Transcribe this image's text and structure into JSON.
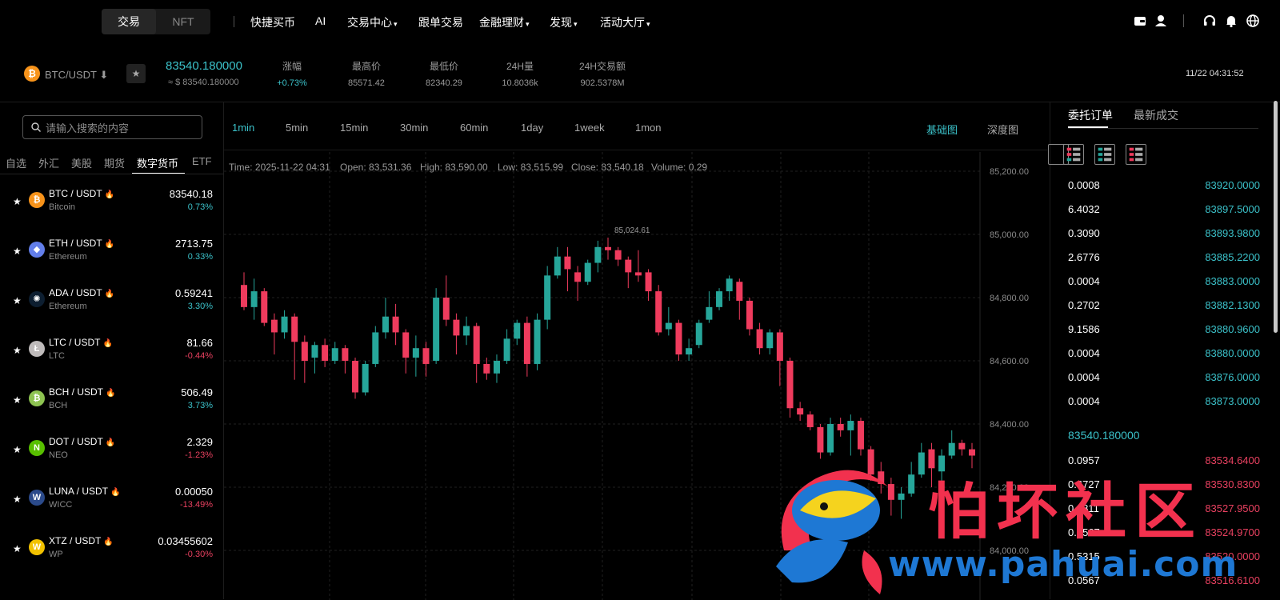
{
  "topnav": {
    "seg_active": "交易",
    "seg_other": "NFT",
    "items": [
      {
        "label": "快捷买币",
        "has_caret": false
      },
      {
        "label": "AI",
        "has_caret": false
      },
      {
        "label": "交易中心",
        "has_caret": true
      },
      {
        "label": "跟单交易",
        "has_caret": false
      },
      {
        "label": "金融理财",
        "has_caret": true
      },
      {
        "label": "发现",
        "has_caret": true
      },
      {
        "label": "活动大厅",
        "has_caret": true
      }
    ],
    "caret_glyph": "▾",
    "right_icons": [
      "wallet-icon",
      "user-icon",
      "headset-icon",
      "bell-icon",
      "globe-icon"
    ]
  },
  "ticker": {
    "pair": "BTC/USDT ⬇",
    "last_price": "83540.180000",
    "approx": "≈ $ 83540.180000",
    "stats": [
      {
        "label": "涨幅",
        "value": "+0.73%",
        "up": true
      },
      {
        "label": "最高价",
        "value": "85571.42",
        "up": false
      },
      {
        "label": "最低价",
        "value": "82340.29",
        "up": false
      },
      {
        "label": "24H量",
        "value": "10.8036k",
        "up": false
      },
      {
        "label": "24H交易额",
        "value": "902.5378M",
        "up": false
      }
    ],
    "clock": "11/22 04:31:52"
  },
  "left": {
    "search_placeholder": "请输入搜索的内容",
    "tabs": [
      "自选",
      "外汇",
      "美股",
      "期货",
      "数字货币",
      "ETF"
    ],
    "active_tab": "数字货币",
    "markets": [
      {
        "symbol": "BTC / USDT",
        "name": "Bitcoin",
        "price": "83540.18",
        "change": "0.73%",
        "dir": "up",
        "icon_color": "#f7931a",
        "icon_glyph": "₿"
      },
      {
        "symbol": "ETH / USDT",
        "name": "Ethereum",
        "price": "2713.75",
        "change": "0.33%",
        "dir": "up",
        "icon_color": "#627eea",
        "icon_glyph": "◆"
      },
      {
        "symbol": "ADA / USDT",
        "name": "Ethereum",
        "price": "0.59241",
        "change": "3.30%",
        "dir": "up",
        "icon_color": "#0d1e30",
        "icon_glyph": "✺"
      },
      {
        "symbol": "LTC / USDT",
        "name": "LTC",
        "price": "81.66",
        "change": "-0.44%",
        "dir": "down",
        "icon_color": "#bfbbbb",
        "icon_glyph": "Ł"
      },
      {
        "symbol": "BCH / USDT",
        "name": "BCH",
        "price": "506.49",
        "change": "3.73%",
        "dir": "up",
        "icon_color": "#8dc351",
        "icon_glyph": "₿"
      },
      {
        "symbol": "DOT / USDT",
        "name": "NEO",
        "price": "2.329",
        "change": "-1.23%",
        "dir": "down",
        "icon_color": "#58bf00",
        "icon_glyph": "N"
      },
      {
        "symbol": "LUNA / USDT",
        "name": "WICC",
        "price": "0.00050",
        "change": "-13.49%",
        "dir": "down",
        "icon_color": "#2b4a8a",
        "icon_glyph": "W"
      },
      {
        "symbol": "XTZ / USDT",
        "name": "WP",
        "price": "0.03455602",
        "change": "-0.30%",
        "dir": "down",
        "icon_color": "#f2c200",
        "icon_glyph": "W"
      }
    ]
  },
  "chart": {
    "intervals": [
      "1min",
      "5min",
      "15min",
      "30min",
      "60min",
      "1day",
      "1week",
      "1mon"
    ],
    "active_interval": "1min",
    "chart_types": [
      "基础图",
      "深度图"
    ],
    "active_type": "基础图",
    "ohlc": {
      "time": "Time: 2025-11-22 04:31",
      "open": "Open: 83,531.36",
      "high": "High: 83,590.00",
      "low": "Low: 83,515.99",
      "close": "Close: 83,540.18",
      "volume": "Volume: 0.29"
    },
    "peak_label": "85,024.61",
    "up_color": "#26a69a",
    "down_color": "#ef3b5d"
  },
  "chart_data": {
    "type": "candlestick",
    "y_ticks": [
      "85,200.00",
      "85,000.00",
      "84,800.00",
      "84,600.00",
      "84,400.00",
      "84,200.00",
      "84,000.00"
    ],
    "ylim": [
      83880,
      85240
    ],
    "candles": [
      [
        84840,
        84770,
        84880,
        84760
      ],
      [
        84770,
        84820,
        84860,
        84730
      ],
      [
        84820,
        84720,
        84830,
        84710
      ],
      [
        84730,
        84690,
        84750,
        84620
      ],
      [
        84690,
        84740,
        84760,
        84670
      ],
      [
        84740,
        84660,
        84750,
        84540
      ],
      [
        84660,
        84600,
        84680,
        84530
      ],
      [
        84610,
        84650,
        84660,
        84560
      ],
      [
        84650,
        84600,
        84670,
        84580
      ],
      [
        84600,
        84640,
        84660,
        84590
      ],
      [
        84640,
        84600,
        84650,
        84560
      ],
      [
        84600,
        84500,
        84610,
        84480
      ],
      [
        84500,
        84590,
        84600,
        84490
      ],
      [
        84590,
        84690,
        84710,
        84580
      ],
      [
        84690,
        84740,
        84800,
        84670
      ],
      [
        84740,
        84690,
        84780,
        84650
      ],
      [
        84690,
        84610,
        84700,
        84560
      ],
      [
        84610,
        84640,
        84680,
        84550
      ],
      [
        84640,
        84590,
        84660,
        84550
      ],
      [
        84600,
        84800,
        84830,
        84590
      ],
      [
        84800,
        84730,
        84870,
        84710
      ],
      [
        84730,
        84680,
        84750,
        84620
      ],
      [
        84680,
        84710,
        84740,
        84650
      ],
      [
        84710,
        84590,
        84720,
        84530
      ],
      [
        84590,
        84560,
        84610,
        84540
      ],
      [
        84560,
        84600,
        84620,
        84530
      ],
      [
        84600,
        84670,
        84700,
        84590
      ],
      [
        84670,
        84720,
        84730,
        84650
      ],
      [
        84720,
        84590,
        84740,
        84550
      ],
      [
        84590,
        84730,
        84750,
        84570
      ],
      [
        84730,
        84870,
        84900,
        84700
      ],
      [
        84870,
        84930,
        84960,
        84860
      ],
      [
        84930,
        84890,
        84960,
        84820
      ],
      [
        84880,
        84850,
        84900,
        84790
      ],
      [
        84850,
        84910,
        84920,
        84840
      ],
      [
        84910,
        84960,
        84980,
        84880
      ],
      [
        84960,
        84950,
        84990,
        84920
      ],
      [
        84950,
        84920,
        84960,
        84900
      ],
      [
        84920,
        84880,
        84930,
        84830
      ],
      [
        84880,
        84870,
        84950,
        84850
      ],
      [
        84880,
        84820,
        84890,
        84790
      ],
      [
        84820,
        84690,
        84840,
        84680
      ],
      [
        84700,
        84720,
        84770,
        84680
      ],
      [
        84720,
        84620,
        84730,
        84600
      ],
      [
        84620,
        84640,
        84670,
        84600
      ],
      [
        84650,
        84720,
        84730,
        84640
      ],
      [
        84730,
        84770,
        84820,
        84720
      ],
      [
        84770,
        84820,
        84830,
        84760
      ],
      [
        84820,
        84860,
        84870,
        84790
      ],
      [
        84850,
        84790,
        84860,
        84730
      ],
      [
        84790,
        84700,
        84800,
        84680
      ],
      [
        84700,
        84640,
        84720,
        84620
      ],
      [
        84640,
        84690,
        84700,
        84620
      ],
      [
        84690,
        84600,
        84700,
        84520
      ],
      [
        84600,
        84450,
        84610,
        84420
      ],
      [
        84450,
        84430,
        84470,
        84410
      ],
      [
        84430,
        84390,
        84440,
        84380
      ],
      [
        84390,
        84310,
        84400,
        84290
      ],
      [
        84310,
        84400,
        84420,
        84300
      ],
      [
        84400,
        84380,
        84420,
        84360
      ],
      [
        84380,
        84410,
        84430,
        84300
      ],
      [
        84410,
        84320,
        84420,
        84300
      ],
      [
        84320,
        84240,
        84330,
        84220
      ],
      [
        84250,
        84210,
        84280,
        84180
      ],
      [
        84210,
        84160,
        84230,
        84110
      ],
      [
        84160,
        84180,
        84200,
        84100
      ],
      [
        84180,
        84240,
        84280,
        84170
      ],
      [
        84240,
        84310,
        84340,
        84230
      ],
      [
        84320,
        84260,
        84340,
        84200
      ],
      [
        84250,
        84300,
        84320,
        84190
      ],
      [
        84300,
        84340,
        84380,
        84290
      ],
      [
        84340,
        84320,
        84350,
        84300
      ],
      [
        84320,
        84300,
        84340,
        84260
      ]
    ]
  },
  "orderbook": {
    "tabs": [
      "委托订单",
      "最新成交"
    ],
    "active_tab": "委托订单",
    "asks": [
      {
        "qty": "0.0008",
        "price": "83920.0000"
      },
      {
        "qty": "6.4032",
        "price": "83897.5000"
      },
      {
        "qty": "0.3090",
        "price": "83893.9800"
      },
      {
        "qty": "2.6776",
        "price": "83885.2200"
      },
      {
        "qty": "0.0004",
        "price": "83883.0000"
      },
      {
        "qty": "0.2702",
        "price": "83882.1300"
      },
      {
        "qty": "9.1586",
        "price": "83880.9600"
      },
      {
        "qty": "0.0004",
        "price": "83880.0000"
      },
      {
        "qty": "0.0004",
        "price": "83876.0000"
      },
      {
        "qty": "0.0004",
        "price": "83873.0000"
      }
    ],
    "mid_price": "83540.180000",
    "bids": [
      {
        "qty": "0.0957",
        "price": "83534.6400"
      },
      {
        "qty": "0.6727",
        "price": "83530.8300"
      },
      {
        "qty": "0.0811",
        "price": "83527.9500"
      },
      {
        "qty": "0.0567",
        "price": "83524.9700"
      },
      {
        "qty": "0.5315",
        "price": "83520.0000"
      },
      {
        "qty": "0.0567",
        "price": "83516.6100"
      }
    ],
    "ask_color": "#3bc1c9",
    "bid_color": "#e94160"
  },
  "watermark": {
    "title": "怕坏社区",
    "url": "www.pahuai.com"
  }
}
